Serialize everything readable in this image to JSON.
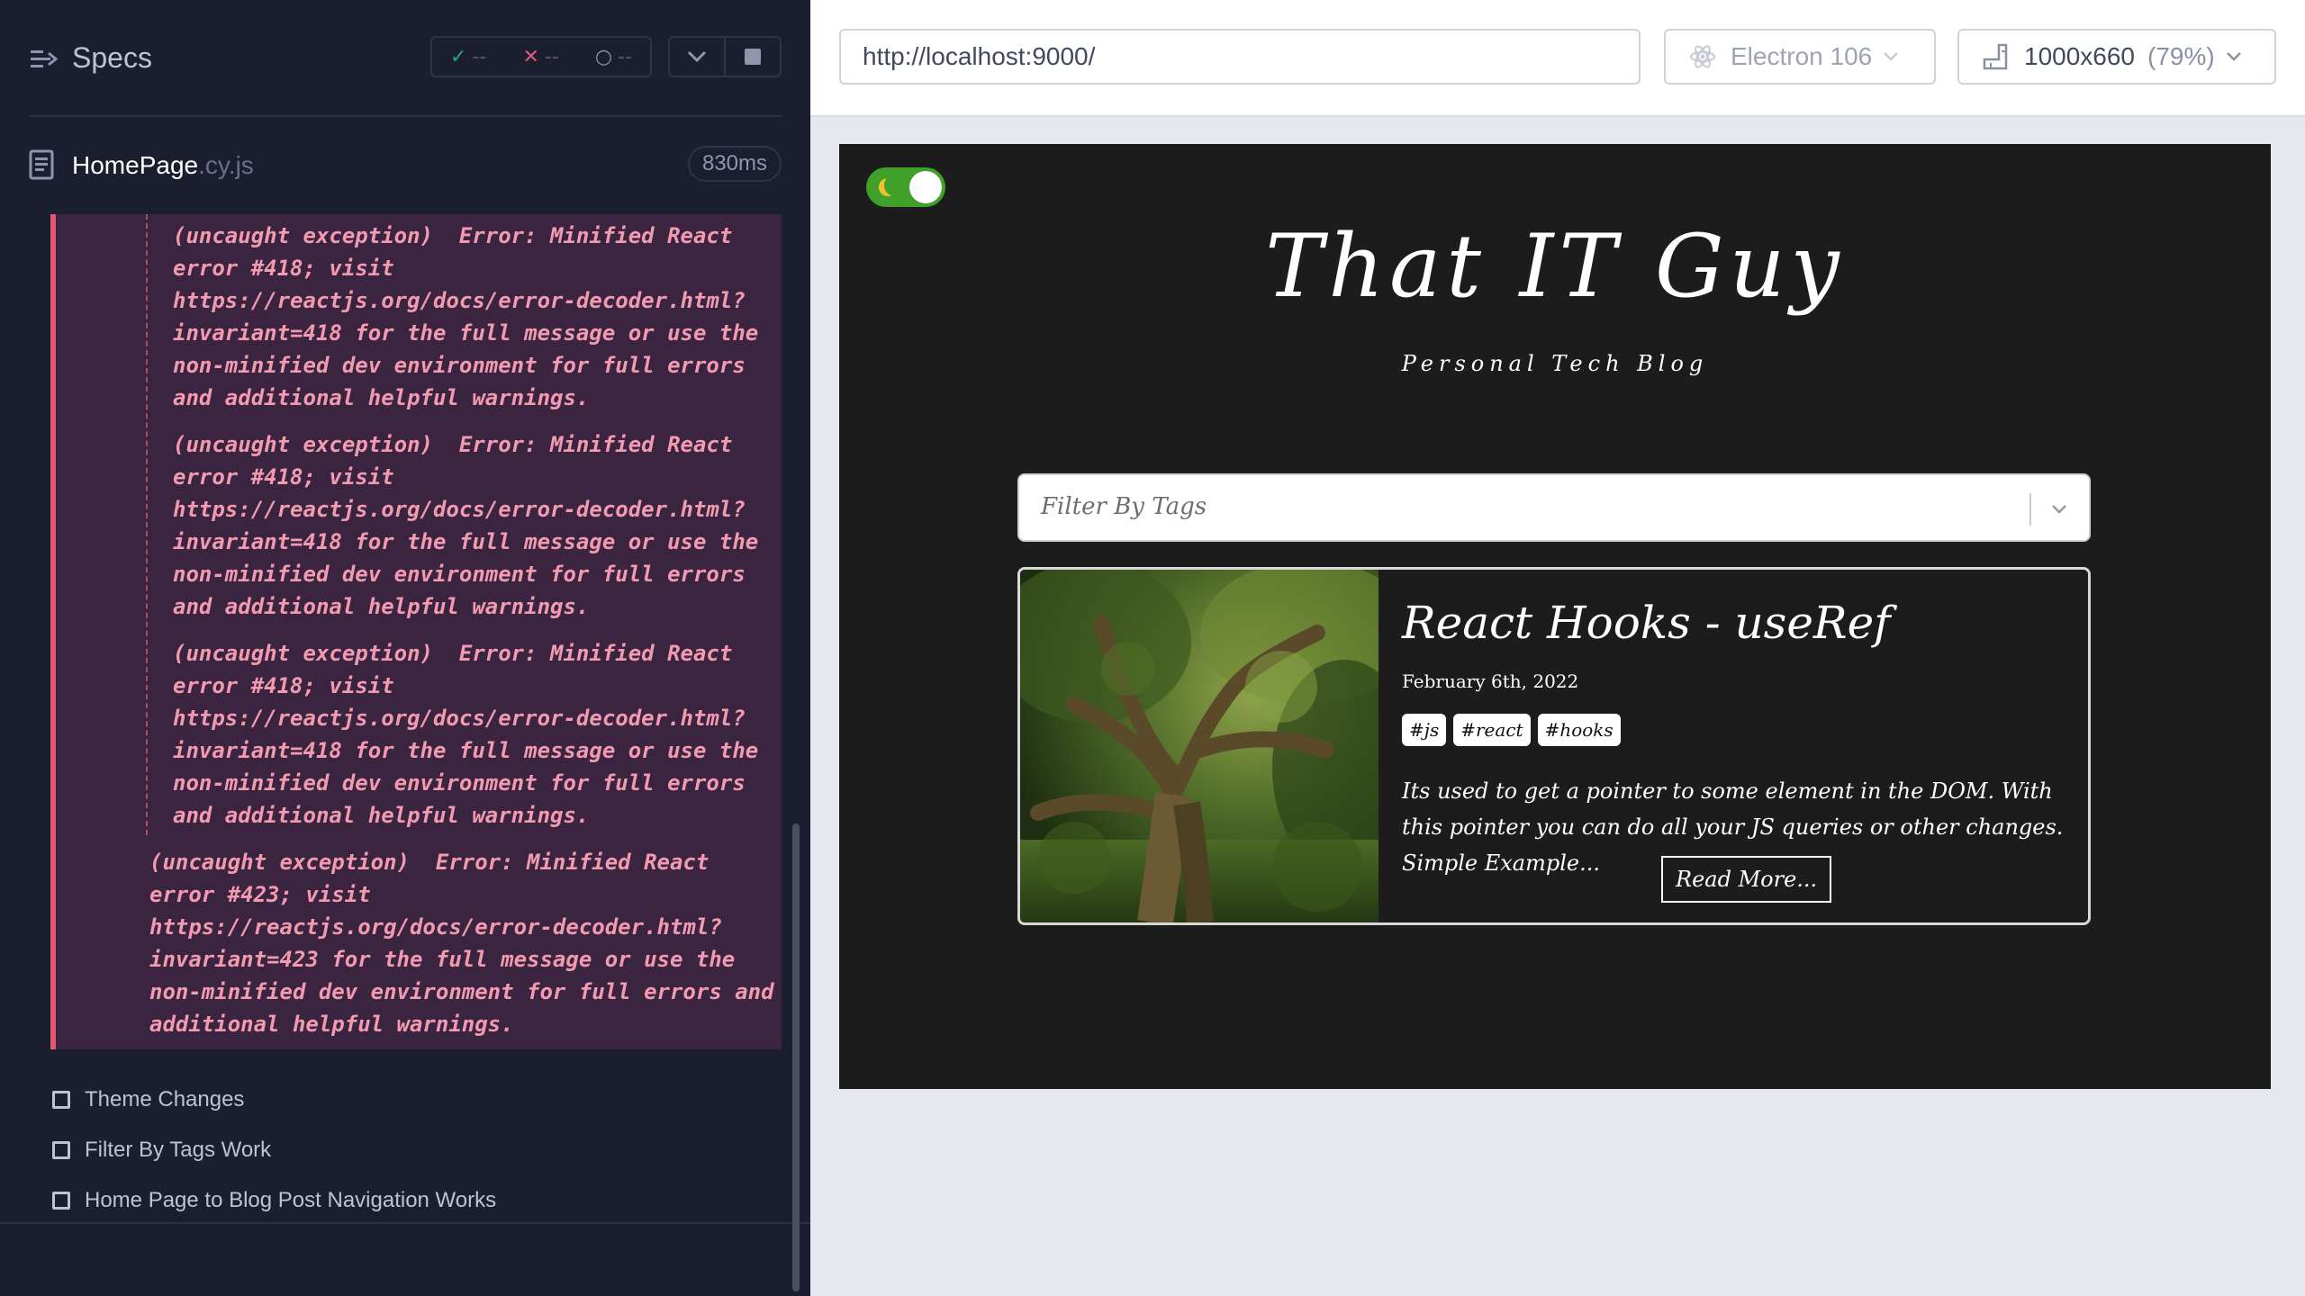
{
  "reporter": {
    "title": "Specs",
    "stats": {
      "passed": "--",
      "failed": "--",
      "pending": "--"
    },
    "spec_file": {
      "name": "HomePage",
      "ext": ".cy.js",
      "duration": "830ms"
    },
    "errors": [
      "(uncaught exception)  Error: Minified React\nerror #418; visit\nhttps://reactjs.org/docs/error-decoder.html?\ninvariant=418 for the full message or use the\nnon-minified dev environment for full errors\nand additional helpful warnings.",
      "(uncaught exception)  Error: Minified React\nerror #418; visit\nhttps://reactjs.org/docs/error-decoder.html?\ninvariant=418 for the full message or use the\nnon-minified dev environment for full errors\nand additional helpful warnings.",
      "(uncaught exception)  Error: Minified React\nerror #418; visit\nhttps://reactjs.org/docs/error-decoder.html?\ninvariant=418 for the full message or use the\nnon-minified dev environment for full errors\nand additional helpful warnings.",
      "(uncaught exception)  Error: Minified React\nerror #423; visit\nhttps://reactjs.org/docs/error-decoder.html?\ninvariant=423 for the full message or use the\nnon-minified dev environment for full errors and\nadditional helpful warnings."
    ],
    "first_error_partial": "(uncaught exception)  Error: Minified React\nerror #418; visit\nhttps://reactjs.org/docs/error-decoder.html?\ninvariant=418 for the full message or use the\nnon-minified dev environment for full errors\nand additional helpful warnings.",
    "tests": [
      {
        "label": "Theme Changes"
      },
      {
        "label": "Filter By Tags Work"
      },
      {
        "label": "Home Page to Blog Post Navigation Works"
      }
    ],
    "colors": {
      "panel_bg": "#1b1e2e",
      "error_bg": "#3b2440",
      "error_accent": "#e45770",
      "pass": "#1fa971"
    }
  },
  "aut_bar": {
    "url": "http://localhost:9000/",
    "browser": "Electron 106",
    "viewport": "1000x660",
    "scale": "(79%)"
  },
  "app": {
    "site_title": "That IT Guy",
    "site_subtitle": "Personal Tech Blog",
    "filter_placeholder": "Filter By Tags",
    "post": {
      "title": "React Hooks - useRef",
      "date": "February 6th, 2022",
      "tags": [
        "#js",
        "#react",
        "#hooks"
      ],
      "excerpt": "Its used to get a pointer to some element in the DOM. With this pointer you can do all your JS queries or other changes. Simple Example...",
      "read_more": "Read More..."
    },
    "colors": {
      "bg": "#1c1c1c",
      "toggle": "#3fa02a"
    },
    "icons": {
      "toggle": "moon-icon",
      "filter": "chevron-down-icon"
    }
  }
}
